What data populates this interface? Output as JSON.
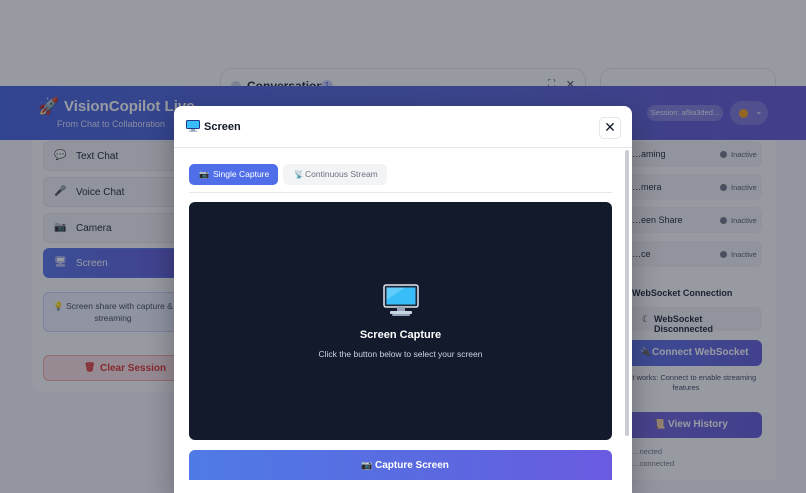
{
  "app": {
    "name": "VisionCopilot Live",
    "tagline": "From Chat to Collaboration",
    "session": "Session: af9a3ded..."
  },
  "conversation": {
    "title": "Conversation",
    "count": "1"
  },
  "sidebar": {
    "modes": [
      {
        "label": "Text Chat",
        "icon": "chat-bubble-icon"
      },
      {
        "label": "Voice Chat",
        "icon": "microphone-icon"
      },
      {
        "label": "Camera",
        "icon": "camera-icon"
      },
      {
        "label": "Screen",
        "icon": "monitor-icon"
      }
    ],
    "hint": "💡 Screen share with capture & streaming",
    "clear_label": "Clear Session"
  },
  "status_panel": {
    "rows": [
      {
        "label": "…aming",
        "value": "Inactive"
      },
      {
        "label": "…mera",
        "value": "Inactive"
      },
      {
        "label": "…een Share",
        "value": "Inactive"
      },
      {
        "label": "…ce",
        "value": "Inactive"
      }
    ],
    "ws_title": "WebSocket Connection",
    "ws_status": "WebSocket Disconnected",
    "ws_connect": "Connect WebSocket",
    "ws_how": "…w it works: Connect to enable streaming features",
    "view_history": "View History",
    "conn_lines": [
      "…nected",
      "…connected"
    ]
  },
  "modal": {
    "title": "Screen",
    "close_glyph": "✕",
    "tabs": [
      {
        "label": "Single Capture",
        "active": true
      },
      {
        "label": "Continuous Stream",
        "active": false
      }
    ],
    "preview_title": "Screen Capture",
    "preview_subtitle": "Click the button below to select your screen",
    "capture_label": "Capture Screen"
  },
  "colors": {
    "accent": "#4f6ee8",
    "header_start": "#3b5bdb",
    "header_end": "#5b4fd0",
    "preview_bg": "#131a2b",
    "danger": "#dc2626"
  }
}
